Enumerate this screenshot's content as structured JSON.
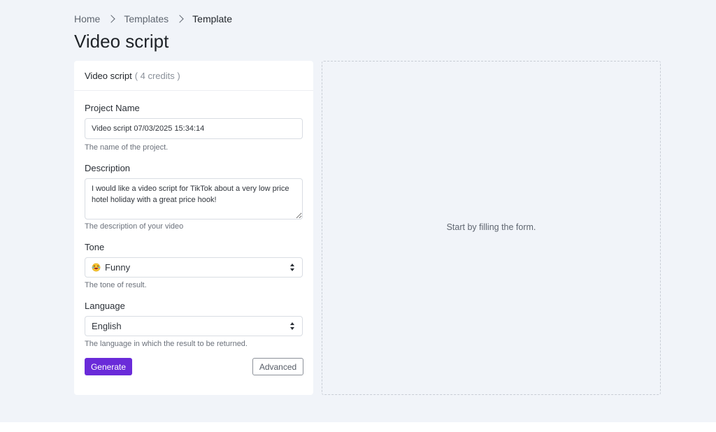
{
  "breadcrumb": {
    "items": [
      "Home",
      "Templates",
      "Template"
    ]
  },
  "page": {
    "title": "Video script"
  },
  "form": {
    "header_name": "Video script",
    "header_credits": "( 4 credits )",
    "project_name": {
      "label": "Project Name",
      "value": "Video script 07/03/2025 15:34:14",
      "help": "The name of the project."
    },
    "description": {
      "label": "Description",
      "value": "I would like a video script for TikTok about a very low price hotel holiday with a great price hook!",
      "help": "The description of your video"
    },
    "tone": {
      "label": "Tone",
      "selected": "Funny",
      "icon": "laughing-emoji-icon",
      "help": "The tone of result."
    },
    "language": {
      "label": "Language",
      "selected": "English",
      "help": "The language in which the result to be returned."
    },
    "generate_label": "Generate",
    "advanced_label": "Advanced"
  },
  "result": {
    "placeholder": "Start by filling the form."
  },
  "colors": {
    "accent": "#6a2bd9",
    "page_background": "#f1f4f9",
    "card_background": "#ffffff"
  }
}
